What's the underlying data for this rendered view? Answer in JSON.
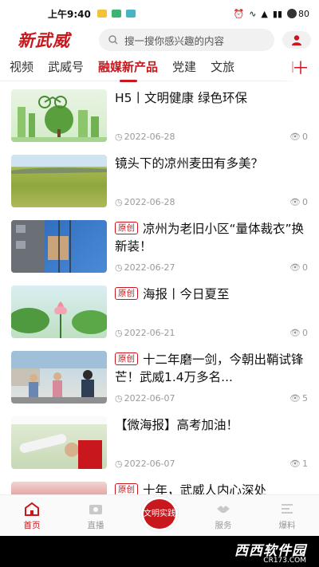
{
  "status_bar": {
    "time": "上午9:40",
    "battery": "80"
  },
  "header": {
    "logo": "新武威",
    "search_placeholder": "搜一搜你感兴趣的内容"
  },
  "tabs": [
    {
      "label": "视频"
    },
    {
      "label": "武威号"
    },
    {
      "label": "融媒新产品",
      "active": true
    },
    {
      "label": "党建"
    },
    {
      "label": "文旅"
    },
    {
      "label": "＋"
    }
  ],
  "feed": [
    {
      "title": "H5丨文明健康 绿色环保",
      "original": false,
      "date": "2022-06-28",
      "views": "0"
    },
    {
      "title": "镜头下的凉州麦田有多美？",
      "original": false,
      "date": "2022-06-28",
      "views": "0"
    },
    {
      "title": "凉州为老旧小区“量体裁衣”换新装！",
      "original": true,
      "date": "2022-06-27",
      "views": "0"
    },
    {
      "title": "海报丨今日夏至",
      "original": true,
      "date": "2022-06-21",
      "views": "0"
    },
    {
      "title": "十二年磨一剑，今朝出鞘试锋芒！武威1.4万多名...",
      "original": true,
      "date": "2022-06-07",
      "views": "5"
    },
    {
      "title": "【微海报】高考加油！",
      "original": false,
      "date": "2022-06-07",
      "views": "1"
    },
    {
      "title": "十年，武威人内心深处",
      "original": true,
      "date": "",
      "views": ""
    }
  ],
  "original_label": "原创",
  "bottom_nav": {
    "home": "首页",
    "live": "直播",
    "center": "文明实践",
    "service": "服务",
    "report": "爆料"
  },
  "watermark": {
    "main": "西西软件园",
    "sub": "CR173.COM"
  },
  "colors": {
    "accent": "#c8171d"
  }
}
